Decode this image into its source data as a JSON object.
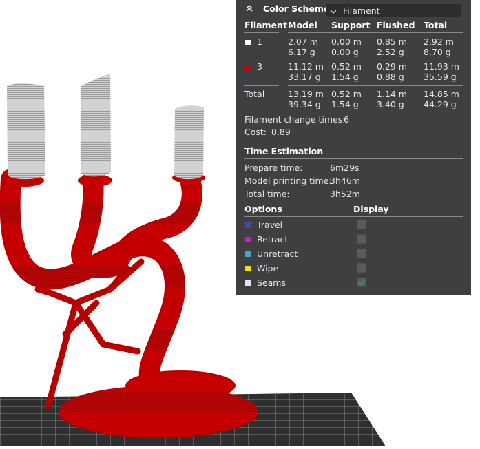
{
  "panel": {
    "title": "Color Scheme",
    "scheme_value": "Filament",
    "columns": [
      "Filament",
      "Model",
      "Support",
      "Flushed",
      "Total"
    ],
    "rows": [
      {
        "id": "1",
        "color": "#ffffff",
        "model": [
          "2.07 m",
          "6.17 g"
        ],
        "support": [
          "0.00 m",
          "0.00 g"
        ],
        "flushed": [
          "0.85 m",
          "2.52 g"
        ],
        "total": [
          "2.92 m",
          "8.70 g"
        ]
      },
      {
        "id": "3",
        "color": "#cc0000",
        "model": [
          "11.12 m",
          "33.17 g"
        ],
        "support": [
          "0.52 m",
          "1.54 g"
        ],
        "flushed": [
          "0.29 m",
          "0.88 g"
        ],
        "total": [
          "11.93 m",
          "35.59 g"
        ]
      }
    ],
    "total_row": {
      "label": "Total",
      "model": [
        "13.19 m",
        "39.34 g"
      ],
      "support": [
        "0.52 m",
        "1.54 g"
      ],
      "flushed": [
        "1.14 m",
        "3.40 g"
      ],
      "total": [
        "14.85 m",
        "44.29 g"
      ]
    },
    "filament_change_label": "Filament change times:",
    "filament_change_value": "6",
    "cost_label": "Cost:",
    "cost_value": "0.89",
    "time_heading": "Time Estimation",
    "prepare_label": "Prepare time:",
    "prepare_value": "6m29s",
    "printing_label": "Model printing time:",
    "printing_value": "3h46m",
    "total_time_label": "Total time:",
    "total_time_value": "3h52m",
    "options_heading": "Options",
    "display_heading": "Display",
    "options": [
      {
        "label": "Travel",
        "color": "#3d4fa8",
        "checked": false
      },
      {
        "label": "Retract",
        "color": "#c31dc5",
        "checked": false
      },
      {
        "label": "Unretract",
        "color": "#45a6c8",
        "checked": false
      },
      {
        "label": "Wipe",
        "color": "#f2e600",
        "checked": false
      },
      {
        "label": "Seams",
        "color": "#e6e6e6",
        "checked": true
      }
    ]
  },
  "colors": {
    "panel_bg": "#3f3f41",
    "model_red": "#c00000",
    "model_white": "#c9c9c9",
    "check_green": "#1fa35a"
  }
}
